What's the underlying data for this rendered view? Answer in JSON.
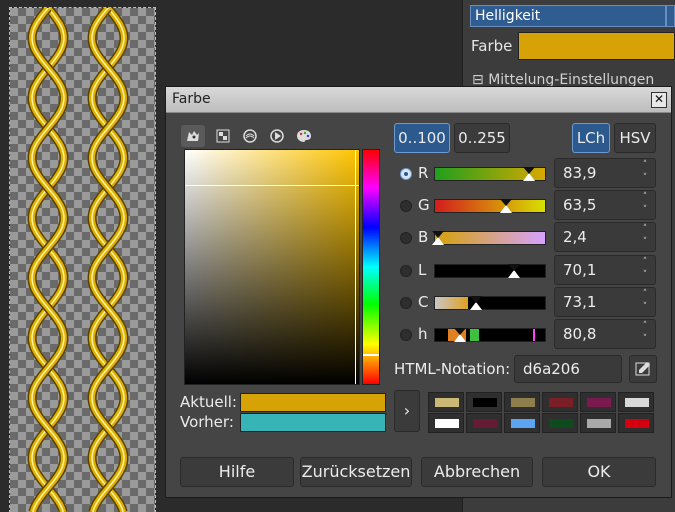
{
  "background": {
    "helligkeit_label": "Helligkeit",
    "farbe_label": "Farbe",
    "farbe_color": "#d6a206",
    "mittelung_label": "Mittelung-Einstellungen",
    "canvas_gold": "#e0b000"
  },
  "dialog": {
    "title": "Farbe",
    "close_glyph": "✕",
    "tool_icons": [
      "gimp-icon",
      "scales-icon",
      "watercolor-icon",
      "triangle-icon",
      "palette-icon"
    ],
    "range_100": "0..100",
    "range_255": "0..255",
    "mode_lch": "LCh",
    "mode_hsv": "HSV",
    "channels": [
      {
        "label": "R",
        "value": "83,9",
        "level": 0.839
      },
      {
        "label": "G",
        "value": "63,5",
        "level": 0.635
      },
      {
        "label": "B",
        "value": "2,4",
        "level": 0.024
      },
      {
        "label": "L",
        "value": "70,1",
        "level": 0.701
      },
      {
        "label": "C",
        "value": "73,1",
        "level": 0.365
      },
      {
        "label": "h",
        "value": "80,8",
        "level": 0.224
      }
    ],
    "html_label": "HTML-Notation:",
    "html_value": "d6a206",
    "current_label": "Aktuell:",
    "previous_label": "Vorher:",
    "current_color": "#d6a206",
    "previous_color": "#37b4b6",
    "history_arrow": "›",
    "history_colors": [
      "#cbb877",
      "#000000",
      "#8f7f4d",
      "#7a1f26",
      "#7a1a4f",
      "#d9d9d9",
      "#ffffff",
      "#651b33",
      "#5ca5f2",
      "#0f4a1e",
      "#a9a9a9",
      "#d40010"
    ],
    "buttons": {
      "help": "Hilfe",
      "reset": "Zurücksetzen",
      "cancel": "Abbrechen",
      "ok": "OK"
    }
  }
}
